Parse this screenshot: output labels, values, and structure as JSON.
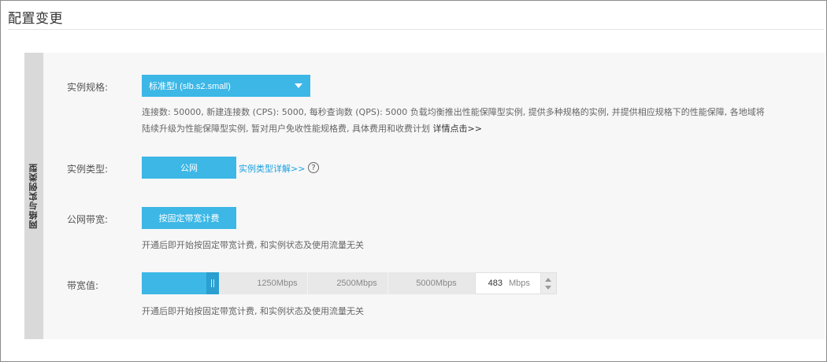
{
  "page": {
    "title": "配置变更"
  },
  "section": {
    "tab_label": "网络与实例类型"
  },
  "instance_spec": {
    "label": "实例规格:",
    "selected": "标准型I (slb.s2.small)",
    "description_line1": "连接数: 50000,  新建连接数 (CPS): 5000,  每秒查询数 (QPS): 5000 负载均衡推出性能保障型实例,  提供多种规格的实例,  并提供相应规格下的性能保障,   各地域将",
    "description_line2": "陆续升级为性能保障型实例,  暂对用户免收性能规格费,  具体费用和收费计划 ",
    "details_link": "详情点击>>"
  },
  "instance_type": {
    "label": "实例类型:",
    "option": "公网",
    "details_link": "实例类型详解>>",
    "help_icon": "?"
  },
  "public_bandwidth": {
    "label": "公网带宽:",
    "option": "按固定带宽计费",
    "hint": "开通后即开始按固定带宽计费,  和实例状态及使用流量无关"
  },
  "bandwidth_value": {
    "label": "带宽值:",
    "ticks": [
      "1250Mbps",
      "2500Mbps",
      "5000Mbps"
    ],
    "value": "483",
    "unit": "Mbps",
    "hint": "开通后即开始按固定带宽计费,  和实例状态及使用流量无关"
  },
  "colors": {
    "accent": "#3cb7e6",
    "accent_dark": "#2a9fd0",
    "link": "#1aa0e0"
  },
  "icons": {
    "dropdown": "caret-down-icon",
    "help": "question-circle-icon",
    "slider": "slider-grip-icon"
  }
}
